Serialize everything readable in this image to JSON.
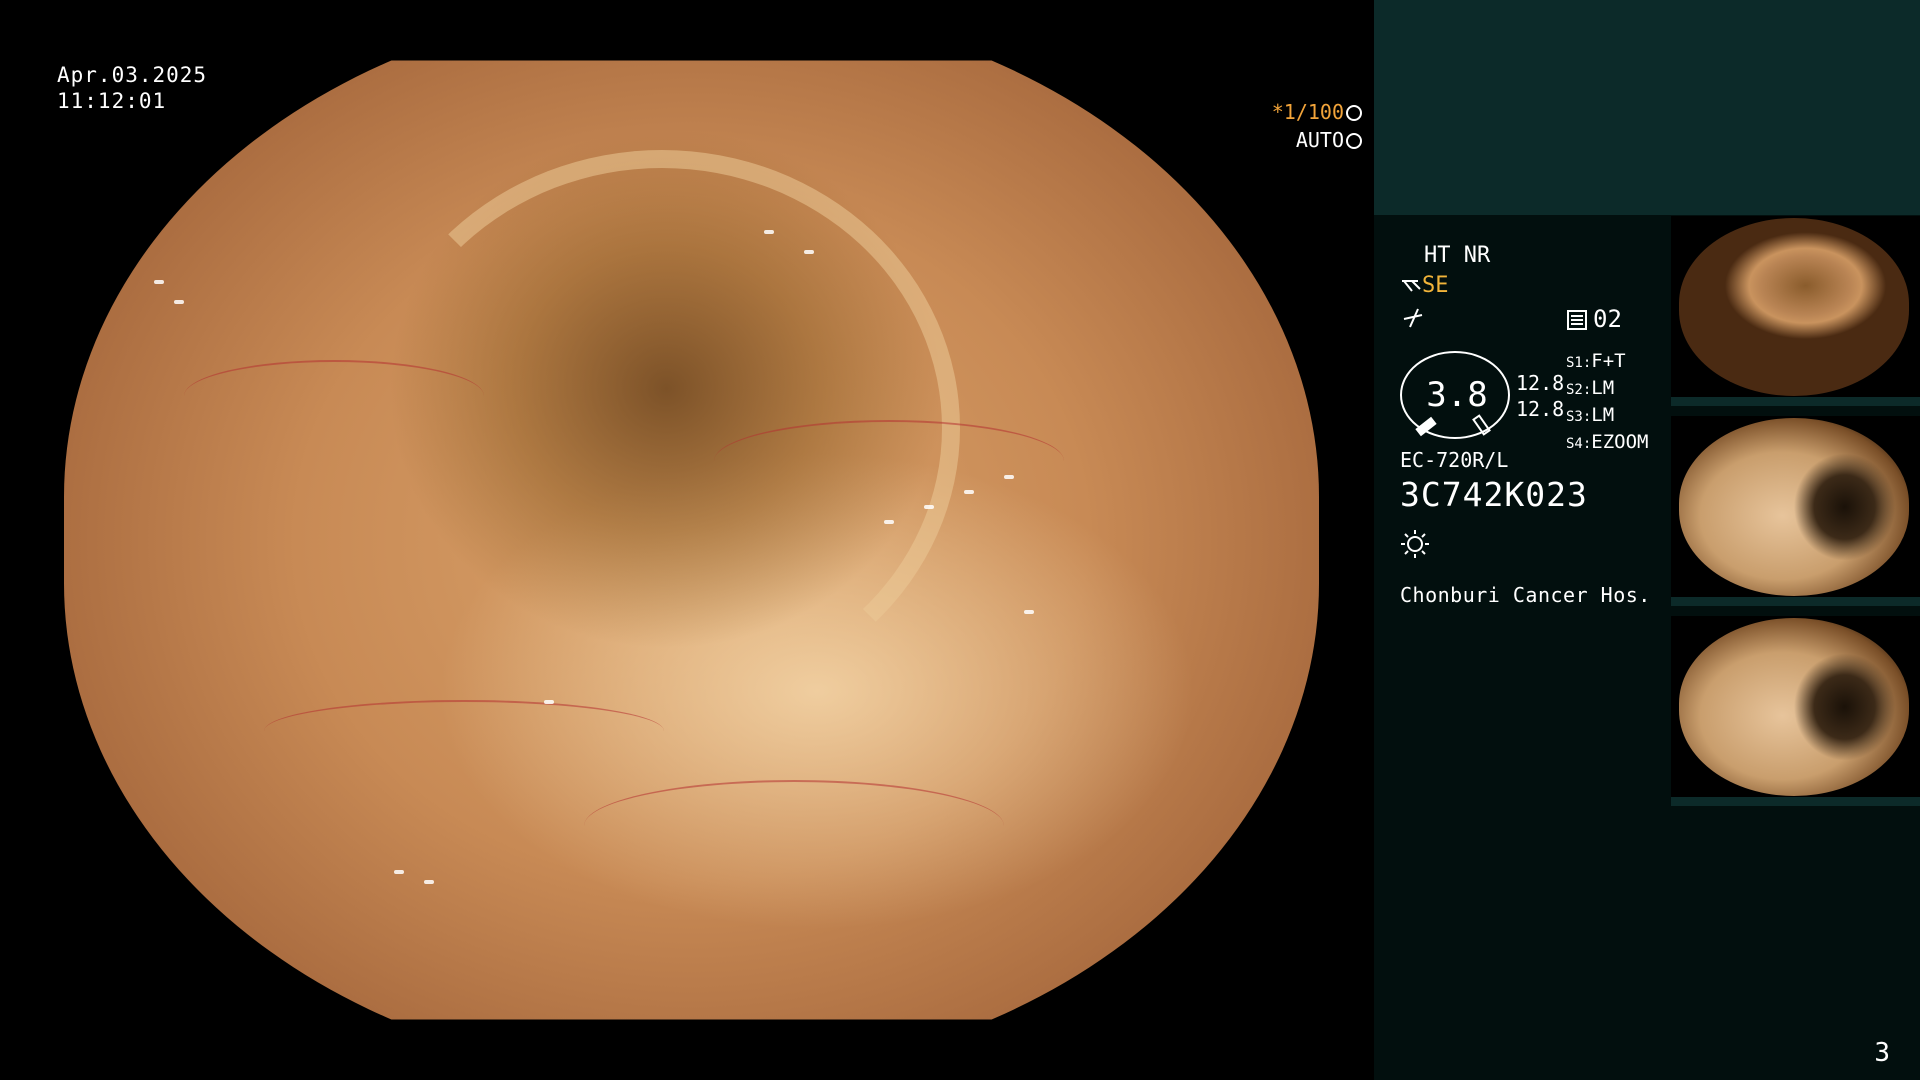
{
  "overlay": {
    "date": "Apr.03.2025",
    "time": "11:12:01",
    "shutter": "*1/100",
    "iris": "AUTO"
  },
  "panel": {
    "mode_ht_nr": "HT NR",
    "mode_se": "SE",
    "memory_channel": "02",
    "gauge_value": "3.8",
    "gain_top": "12.8",
    "gain_bottom": "12.8",
    "switches": [
      {
        "label": "S1:",
        "value": "F+T"
      },
      {
        "label": "S2:",
        "value": "LM"
      },
      {
        "label": "S3:",
        "value": "LM"
      },
      {
        "label": "S4:",
        "value": "EZOOM"
      }
    ],
    "scope_model": "EC-720R/L",
    "scope_serial": "3C742K023",
    "hospital": "Chonburi Cancer Hos.",
    "accent_color": "#f2b43a"
  },
  "page_number": "3",
  "icons": [
    "lens-icon",
    "aperture-icon",
    "scissor-icon",
    "wave-icon",
    "memory-icon",
    "light-icon"
  ]
}
